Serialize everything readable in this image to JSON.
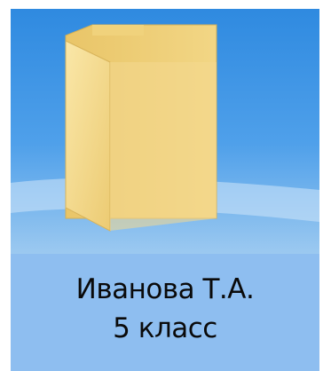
{
  "desktop_item": {
    "icon": "folder-icon",
    "name_line1": "Иванова Т.А.",
    "name_line2": "5 класс",
    "selected": true
  },
  "colors": {
    "selection_background": "#8ebef0",
    "icon_background": "#4d9be1",
    "folder_face": "#f6d98e",
    "folder_back": "#e8c56a"
  }
}
